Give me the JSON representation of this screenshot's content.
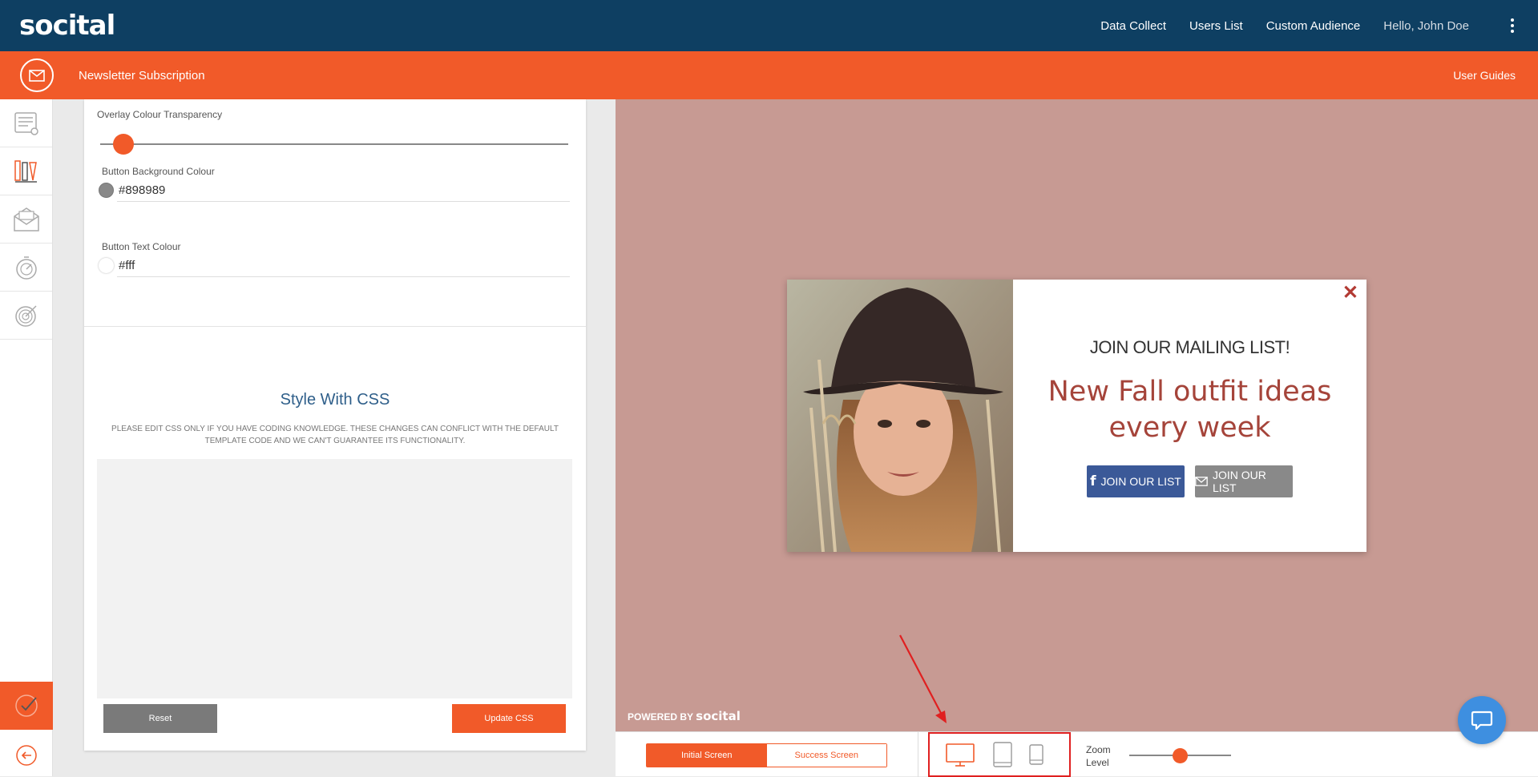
{
  "app": {
    "logo": "socital"
  },
  "topnav": {
    "items": [
      "Data Collect",
      "Users List",
      "Custom Audience"
    ],
    "greeting": "Hello, John Doe"
  },
  "subbar": {
    "title": "Newsletter Subscription",
    "guides": "User Guides"
  },
  "settings": {
    "overlay_label": "Overlay Colour Transparency",
    "overlay_level": 0.05,
    "btn_bg_label": "Button Background Colour",
    "btn_bg_value": "#898989",
    "btn_text_label": "Button Text Colour",
    "btn_text_value": "#fff"
  },
  "css": {
    "title": "Style With CSS",
    "note": "PLEASE EDIT CSS ONLY IF YOU HAVE CODING KNOWLEDGE. THESE CHANGES CAN CONFLICT WITH THE DEFAULT TEMPLATE CODE AND WE CAN'T GUARANTEE ITS FUNCTIONALITY.",
    "reset": "Reset",
    "update": "Update CSS"
  },
  "popup": {
    "heading": "JOIN OUR MAILING LIST!",
    "subheading": "New Fall outfit ideas every week",
    "btn_facebook": "JOIN OUR LIST",
    "btn_email": "JOIN OUR LIST",
    "close": "✕"
  },
  "preview": {
    "powered_prefix": "POWERED BY",
    "powered_brand": "socital"
  },
  "bottombar": {
    "initial": "Initial Screen",
    "success": "Success Screen",
    "zoom_label_1": "Zoom",
    "zoom_label_2": "Level"
  },
  "colors": {
    "navy": "#0e3f62",
    "accent": "#f15a29",
    "preview_bg": "#c79a93",
    "headline": "#a5443a",
    "facebook": "#3b5998",
    "email_btn": "#898989"
  }
}
